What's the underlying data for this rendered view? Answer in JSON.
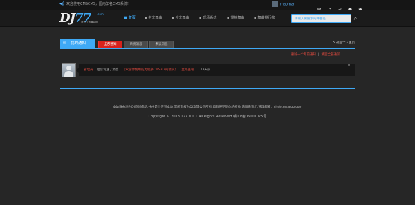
{
  "topbar": {
    "notice": "欢迎使用CMSCMS，国内知名CMS系统!",
    "username": "maoman",
    "icons": [
      "mail-icon",
      "music-icon",
      "share-icon",
      "user-icon",
      "settings-icon"
    ]
  },
  "header": {
    "logo_dj": "DJ",
    "logo_77": "77",
    "logo_com": ".com",
    "logo_slogan": "音乐打造舞曲网",
    "nav": [
      "首页",
      "中文舞曲",
      "外文舞曲",
      "现场系统",
      "慢摇舞曲",
      "舞曲排行榜"
    ],
    "search_placeholder": "请输入要搜索的舞曲名"
  },
  "panel": {
    "title": "我的通知",
    "tabs": [
      "全部通知",
      "系统消息",
      "未读消息"
    ],
    "active_tab": 0,
    "home_link": "返回个人主页",
    "action_delete_month": "删除一个月前通知",
    "action_separator": "|",
    "action_clear_all": "清空全部通知"
  },
  "message": {
    "sender": "管理员",
    "verb": "给您发送了消息",
    "content": "《欢迎你使用成为程序CMS3.7的会员》",
    "link": "立即查看",
    "time": "13天前",
    "close": "×"
  },
  "footer": {
    "line1": "本站舞曲均为DJ原创作品,并由是上传到本站,其所有权为DJ及其公司所有,如有侵犯到你的权益,请联系我们,管理邮箱：chshcms@qq.com",
    "line2": "Copyright © 2013 127.0.0.1 All Rights Reserved 赣ICP备06001075号"
  },
  "colors": {
    "accent": "#3fa9f5",
    "alert_red": "#e04a3f",
    "tab_red": "#d9221c",
    "background": "#262626"
  }
}
